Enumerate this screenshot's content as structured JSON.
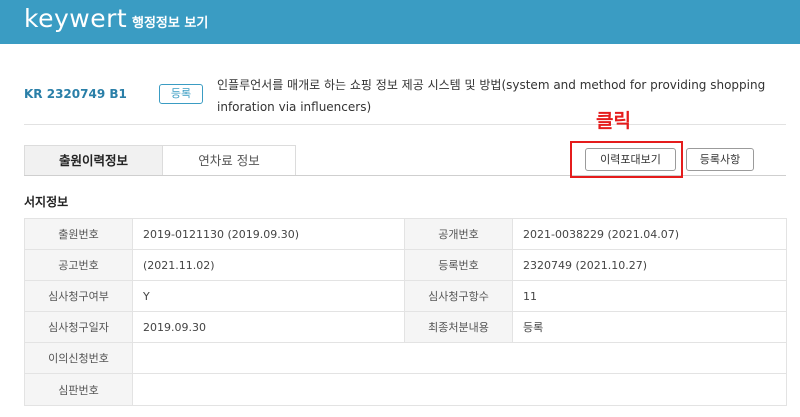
{
  "header": {
    "brand": "keywert",
    "page_title": "행정정보 보기"
  },
  "patent": {
    "number": "KR 2320749 B1",
    "status_badge": "등록",
    "title": "인플루언서를 매개로 하는 쇼핑 정보 제공 시스템 및 방법(system and method for providing shopping inforation via influencers)"
  },
  "tabs": [
    {
      "label": "출원이력정보",
      "active": true
    },
    {
      "label": "연차료 정보",
      "active": false
    }
  ],
  "annotation": {
    "label": "클릭",
    "color": "#e51c1c"
  },
  "actions": {
    "history_view": "이력포대보기",
    "registration": "등록사항"
  },
  "section_title": "서지정보",
  "info_table": {
    "rows": [
      {
        "label1": "출원번호",
        "value1": "2019-0121130 (2019.09.30)",
        "label2": "공개번호",
        "value2": "2021-0038229 (2021.04.07)"
      },
      {
        "label1": "공고번호",
        "value1": "(2021.11.02)",
        "label2": "등록번호",
        "value2": "2320749 (2021.10.27)"
      },
      {
        "label1": "심사청구여부",
        "value1": "Y",
        "label2": "심사청구항수",
        "value2": "11"
      },
      {
        "label1": "심사청구일자",
        "value1": "2019.09.30",
        "label2": "최종처분내용",
        "value2": "등록"
      },
      {
        "label1": "이의신청번호",
        "value1": ""
      },
      {
        "label1": "심판번호",
        "value1": ""
      }
    ]
  },
  "colors": {
    "brand_bar": "#3a9cc3",
    "accent_text": "#2a7fa8",
    "highlight": "#e51c1c"
  },
  "icons": []
}
